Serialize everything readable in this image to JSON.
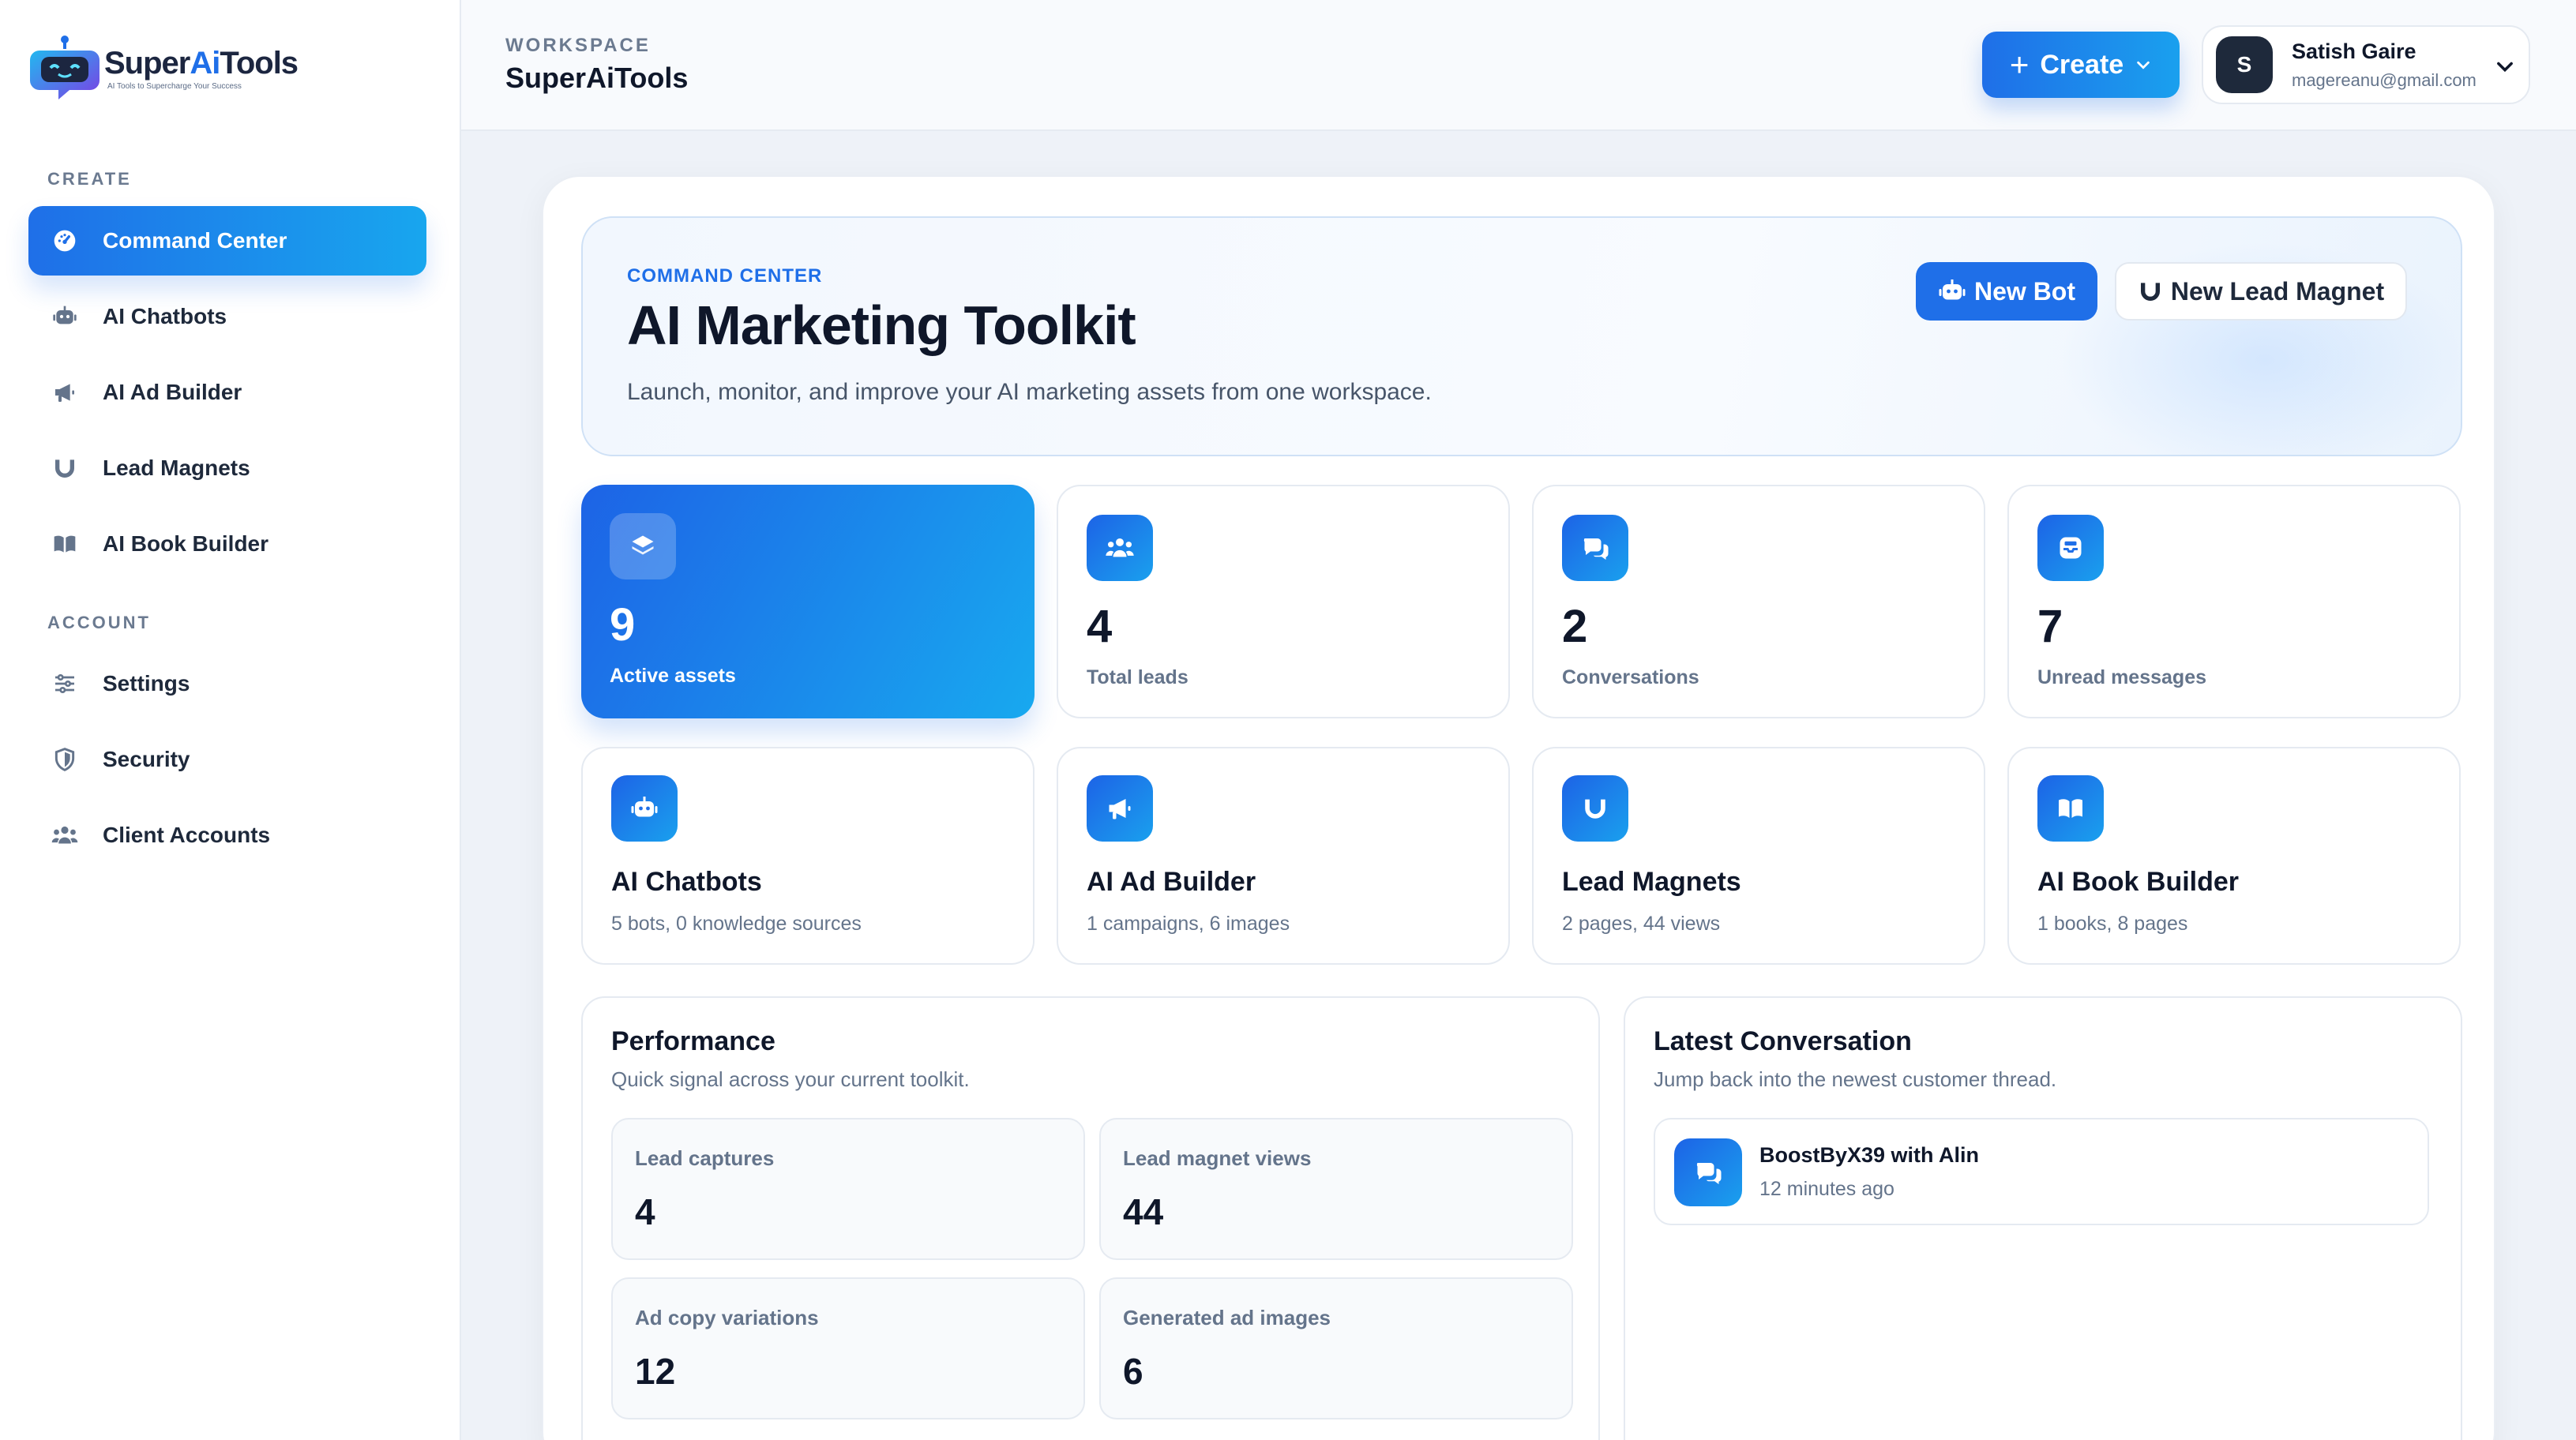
{
  "brand": {
    "name_part1": "Super",
    "name_ai": "Ai",
    "name_part2": "Tools",
    "tagline": "AI Tools to Supercharge Your Success",
    "accent": "#1f6fe8"
  },
  "sidebar": {
    "create_label": "CREATE",
    "account_label": "ACCOUNT",
    "create_items": [
      {
        "label": "Command Center",
        "icon": "gauge-icon",
        "active": true
      },
      {
        "label": "AI Chatbots",
        "icon": "robot-icon"
      },
      {
        "label": "AI Ad Builder",
        "icon": "megaphone-icon"
      },
      {
        "label": "Lead Magnets",
        "icon": "magnet-icon"
      },
      {
        "label": "AI Book Builder",
        "icon": "book-icon"
      }
    ],
    "account_items": [
      {
        "label": "Settings",
        "icon": "sliders-icon"
      },
      {
        "label": "Security",
        "icon": "shield-icon"
      },
      {
        "label": "Client Accounts",
        "icon": "users-icon"
      }
    ]
  },
  "topbar": {
    "workspace_label": "WORKSPACE",
    "workspace_name": "SuperAiTools",
    "create_label": "Create",
    "user": {
      "initial": "S",
      "name": "Satish Gaire",
      "email": "magereanu@gmail.com"
    }
  },
  "hero": {
    "eyebrow": "COMMAND CENTER",
    "title": "AI Marketing Toolkit",
    "subtitle": "Launch, monitor, and improve your AI marketing assets from one workspace.",
    "new_bot_label": "New Bot",
    "new_lead_magnet_label": "New Lead Magnet"
  },
  "stats": [
    {
      "value": "9",
      "label": "Active assets",
      "icon": "layers-icon"
    },
    {
      "value": "4",
      "label": "Total leads",
      "icon": "users-icon"
    },
    {
      "value": "2",
      "label": "Conversations",
      "icon": "chat-icon"
    },
    {
      "value": "7",
      "label": "Unread messages",
      "icon": "inbox-icon"
    }
  ],
  "tools": [
    {
      "title": "AI Chatbots",
      "subtitle": "5 bots, 0 knowledge sources",
      "icon": "robot-icon"
    },
    {
      "title": "AI Ad Builder",
      "subtitle": "1 campaigns, 6 images",
      "icon": "megaphone-icon"
    },
    {
      "title": "Lead Magnets",
      "subtitle": "2 pages, 44 views",
      "icon": "magnet-icon"
    },
    {
      "title": "AI Book Builder",
      "subtitle": "1 books, 8 pages",
      "icon": "book-icon"
    }
  ],
  "performance": {
    "title": "Performance",
    "subtitle": "Quick signal across your current toolkit.",
    "metrics": [
      {
        "label": "Lead captures",
        "value": "4"
      },
      {
        "label": "Lead magnet views",
        "value": "44"
      },
      {
        "label": "Ad copy variations",
        "value": "12"
      },
      {
        "label": "Generated ad images",
        "value": "6"
      }
    ]
  },
  "latest": {
    "title": "Latest Conversation",
    "subtitle": "Jump back into the newest customer thread.",
    "conversation": {
      "name": "BoostByX39 with Alin",
      "time": "12 minutes ago"
    }
  }
}
